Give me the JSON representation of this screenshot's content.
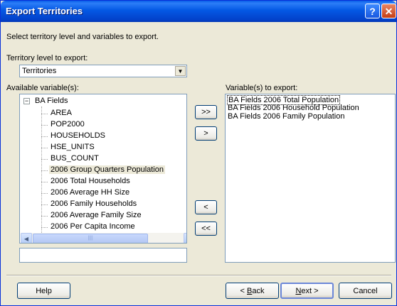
{
  "window": {
    "title": "Export Territories",
    "help_glyph": "?",
    "close_glyph": "✕"
  },
  "intro": "Select territory level and variables to export.",
  "territory_level": {
    "label": "Territory level to export:",
    "selected": "Territories"
  },
  "available": {
    "label": "Available variable(s):",
    "root": "BA Fields",
    "items": [
      "AREA",
      "POP2000",
      "HOUSEHOLDS",
      "HSE_UNITS",
      "BUS_COUNT",
      "2006 Group Quarters Population",
      "2006 Total Households",
      "2006 Average HH Size",
      "2006 Family Households",
      "2006 Average Family Size",
      "2006 Per Capita Income"
    ],
    "selected_index": 5,
    "scroll_thumb_grip": "||||"
  },
  "transfer_buttons": {
    "add_all": ">>",
    "add": ">",
    "remove": "<",
    "remove_all": "<<"
  },
  "export": {
    "label": "Variable(s) to export:",
    "items": [
      "BA Fields 2006 Total Population",
      "BA Fields 2006 Household Population",
      "BA Fields 2006 Family Population"
    ]
  },
  "footer": {
    "help": "Help",
    "back_prefix": "< ",
    "back_key": "B",
    "back_rest": "ack",
    "next_key": "N",
    "next_rest": "ext >",
    "cancel": "Cancel"
  }
}
